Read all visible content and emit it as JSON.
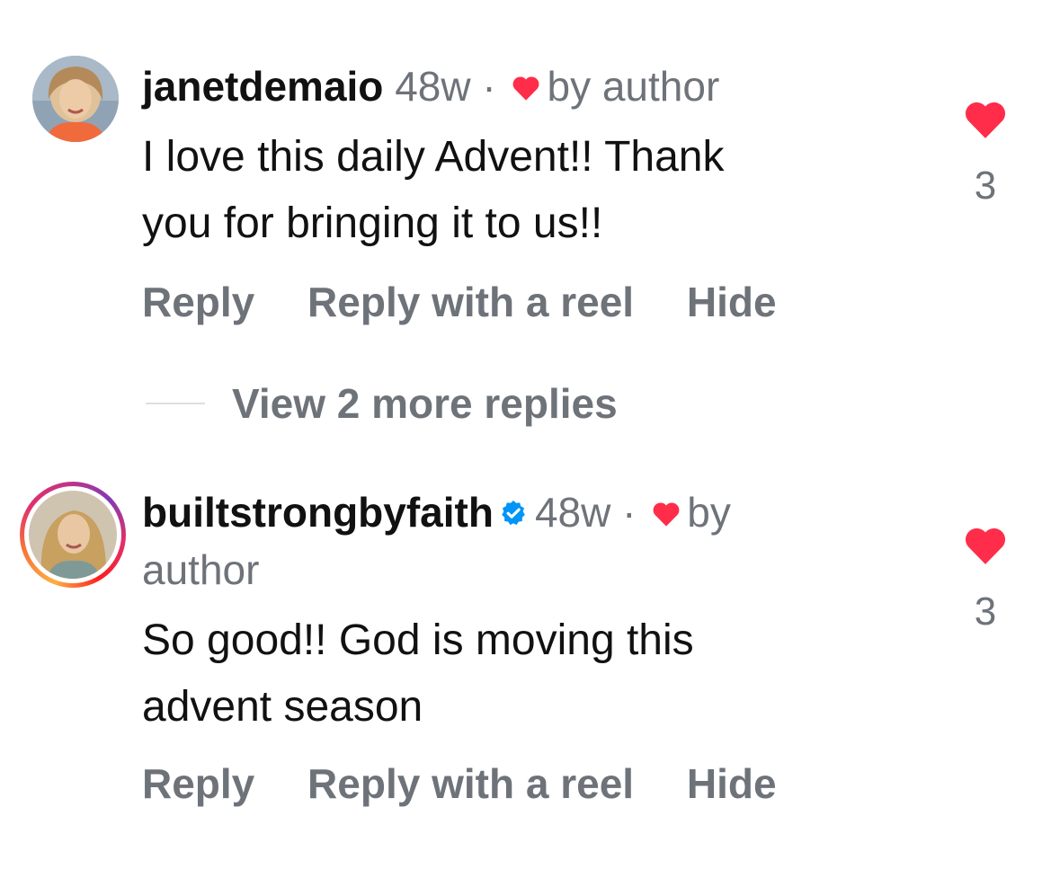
{
  "comments": [
    {
      "username": "janetdemaio",
      "verified": false,
      "time": "48w",
      "separator": "·",
      "liked_by": "by author",
      "text_line1": "I love this daily Advent!! Thank",
      "text_line2": "you for bringing it to us!!",
      "actions": {
        "reply": "Reply",
        "reply_reel": "Reply with a reel",
        "hide": "Hide"
      },
      "like_count": "3"
    },
    {
      "username": "builtstrongbyfaith",
      "verified": true,
      "time": "48w",
      "separator": "·",
      "liked_by_1": "by",
      "liked_by_2": "author",
      "text_line1": "So good!! God is moving this",
      "text_line2": "advent season",
      "actions": {
        "reply": "Reply",
        "reply_reel": "Reply with a reel",
        "hide": "Hide"
      },
      "like_count": "3"
    }
  ],
  "view_replies": "View 2 more replies",
  "colors": {
    "heart": "#ff2d4a",
    "muted_text": "#6e737a",
    "verified_blue": "#0095f6"
  },
  "icons": [
    "heart-icon",
    "verified-badge-icon"
  ]
}
